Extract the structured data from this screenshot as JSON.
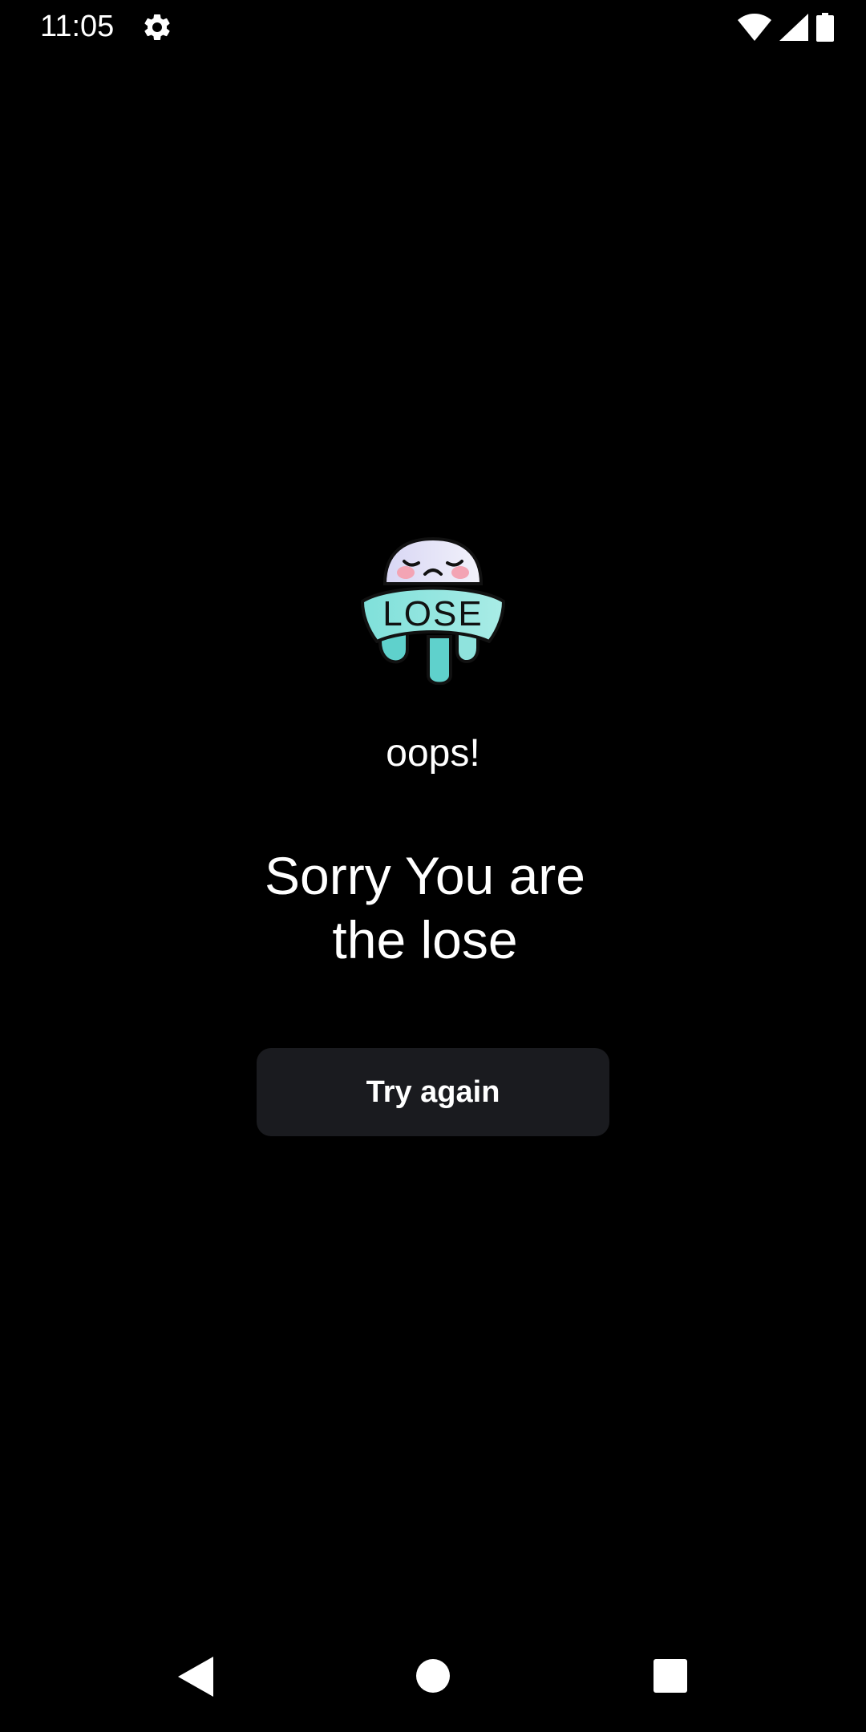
{
  "status_bar": {
    "time": "11:05",
    "icons": [
      "gear-icon",
      "wifi-icon",
      "cellular-signal-icon",
      "battery-icon"
    ]
  },
  "illustration": {
    "icon": "lose-ghost-icon",
    "badge_text": "LOSE"
  },
  "main": {
    "subtitle": "oops!",
    "headline": "Sorry You are the lose",
    "button_label": "Try again"
  },
  "nav_bar": {
    "icons": [
      "back-icon",
      "home-icon",
      "recents-icon"
    ]
  },
  "colors": {
    "background": "#000000",
    "text": "#ffffff",
    "button_bg": "#1a1b1f",
    "accent_teal": "#7fe0da"
  }
}
